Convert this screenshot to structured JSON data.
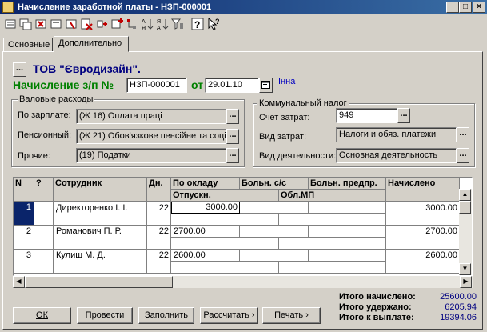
{
  "window": {
    "title": "Начисление заработной платы - НЗП-000001"
  },
  "tabs": [
    {
      "label": "Основные"
    },
    {
      "label": "Дополнительно"
    }
  ],
  "header": {
    "org_button": "...",
    "org_name": "ТОВ \"Євродизайн\".",
    "doc_label": "Начисление з/п №",
    "doc_number": "НЗП-000001",
    "date_label": "от",
    "date_value": "29.01.10",
    "author": "Інна"
  },
  "gross": {
    "title": "Валовые расходы",
    "rows": [
      {
        "label": "По зарплате:",
        "value": "(Ж 16) Оплата праці"
      },
      {
        "label": "Пенсионный:",
        "value": "(Ж 21) Обов'язкове пенсійне та соці"
      },
      {
        "label": "Прочие:",
        "value": "(19) Податки"
      }
    ]
  },
  "communal": {
    "title": "Коммунальный налог",
    "rows": [
      {
        "label": "Счет затрат:",
        "value": "949"
      },
      {
        "label": "Вид затрат:",
        "value": "Налоги и обяз. платежи"
      },
      {
        "label": "Вид деятельности:",
        "value": "Основная деятельность"
      }
    ]
  },
  "table": {
    "headers": {
      "n": "N",
      "q": "?",
      "employee": "Сотрудник",
      "days": "Дн.",
      "salary": "По окладу",
      "vacation": "Отпускн.",
      "sick_cc": "Больн. с/с",
      "sick_ent": "Больн. предпр.",
      "obl_mp": "Обл.МП",
      "accrued": "Начислено"
    },
    "rows": [
      {
        "n": "1",
        "employee": "Директоренко І. І.",
        "days": "22",
        "salary": "3000.00",
        "accrued": "3000.00"
      },
      {
        "n": "2",
        "employee": "Романович П. Р.",
        "days": "22",
        "salary": "2700.00",
        "accrued": "2700.00"
      },
      {
        "n": "3",
        "employee": "Кулиш М. Д.",
        "days": "22",
        "salary": "2600.00",
        "accrued": "2600.00"
      }
    ]
  },
  "buttons": {
    "ok": "ОК",
    "post": "Провести",
    "fill": "Заполнить",
    "calc": "Рассчитать",
    "print": "Печать"
  },
  "totals": {
    "accrued_label": "Итого начислено:",
    "accrued_value": "25600.00",
    "withheld_label": "Итого удержано:",
    "withheld_value": "6205.94",
    "payout_label": "Итого к выплате:",
    "payout_value": "19394.06"
  },
  "colors": {
    "titlebar": "#0a246a",
    "link": "#000080",
    "doc_label": "#008000",
    "totals_value": "#000080",
    "selected_row": "#0a246a"
  }
}
